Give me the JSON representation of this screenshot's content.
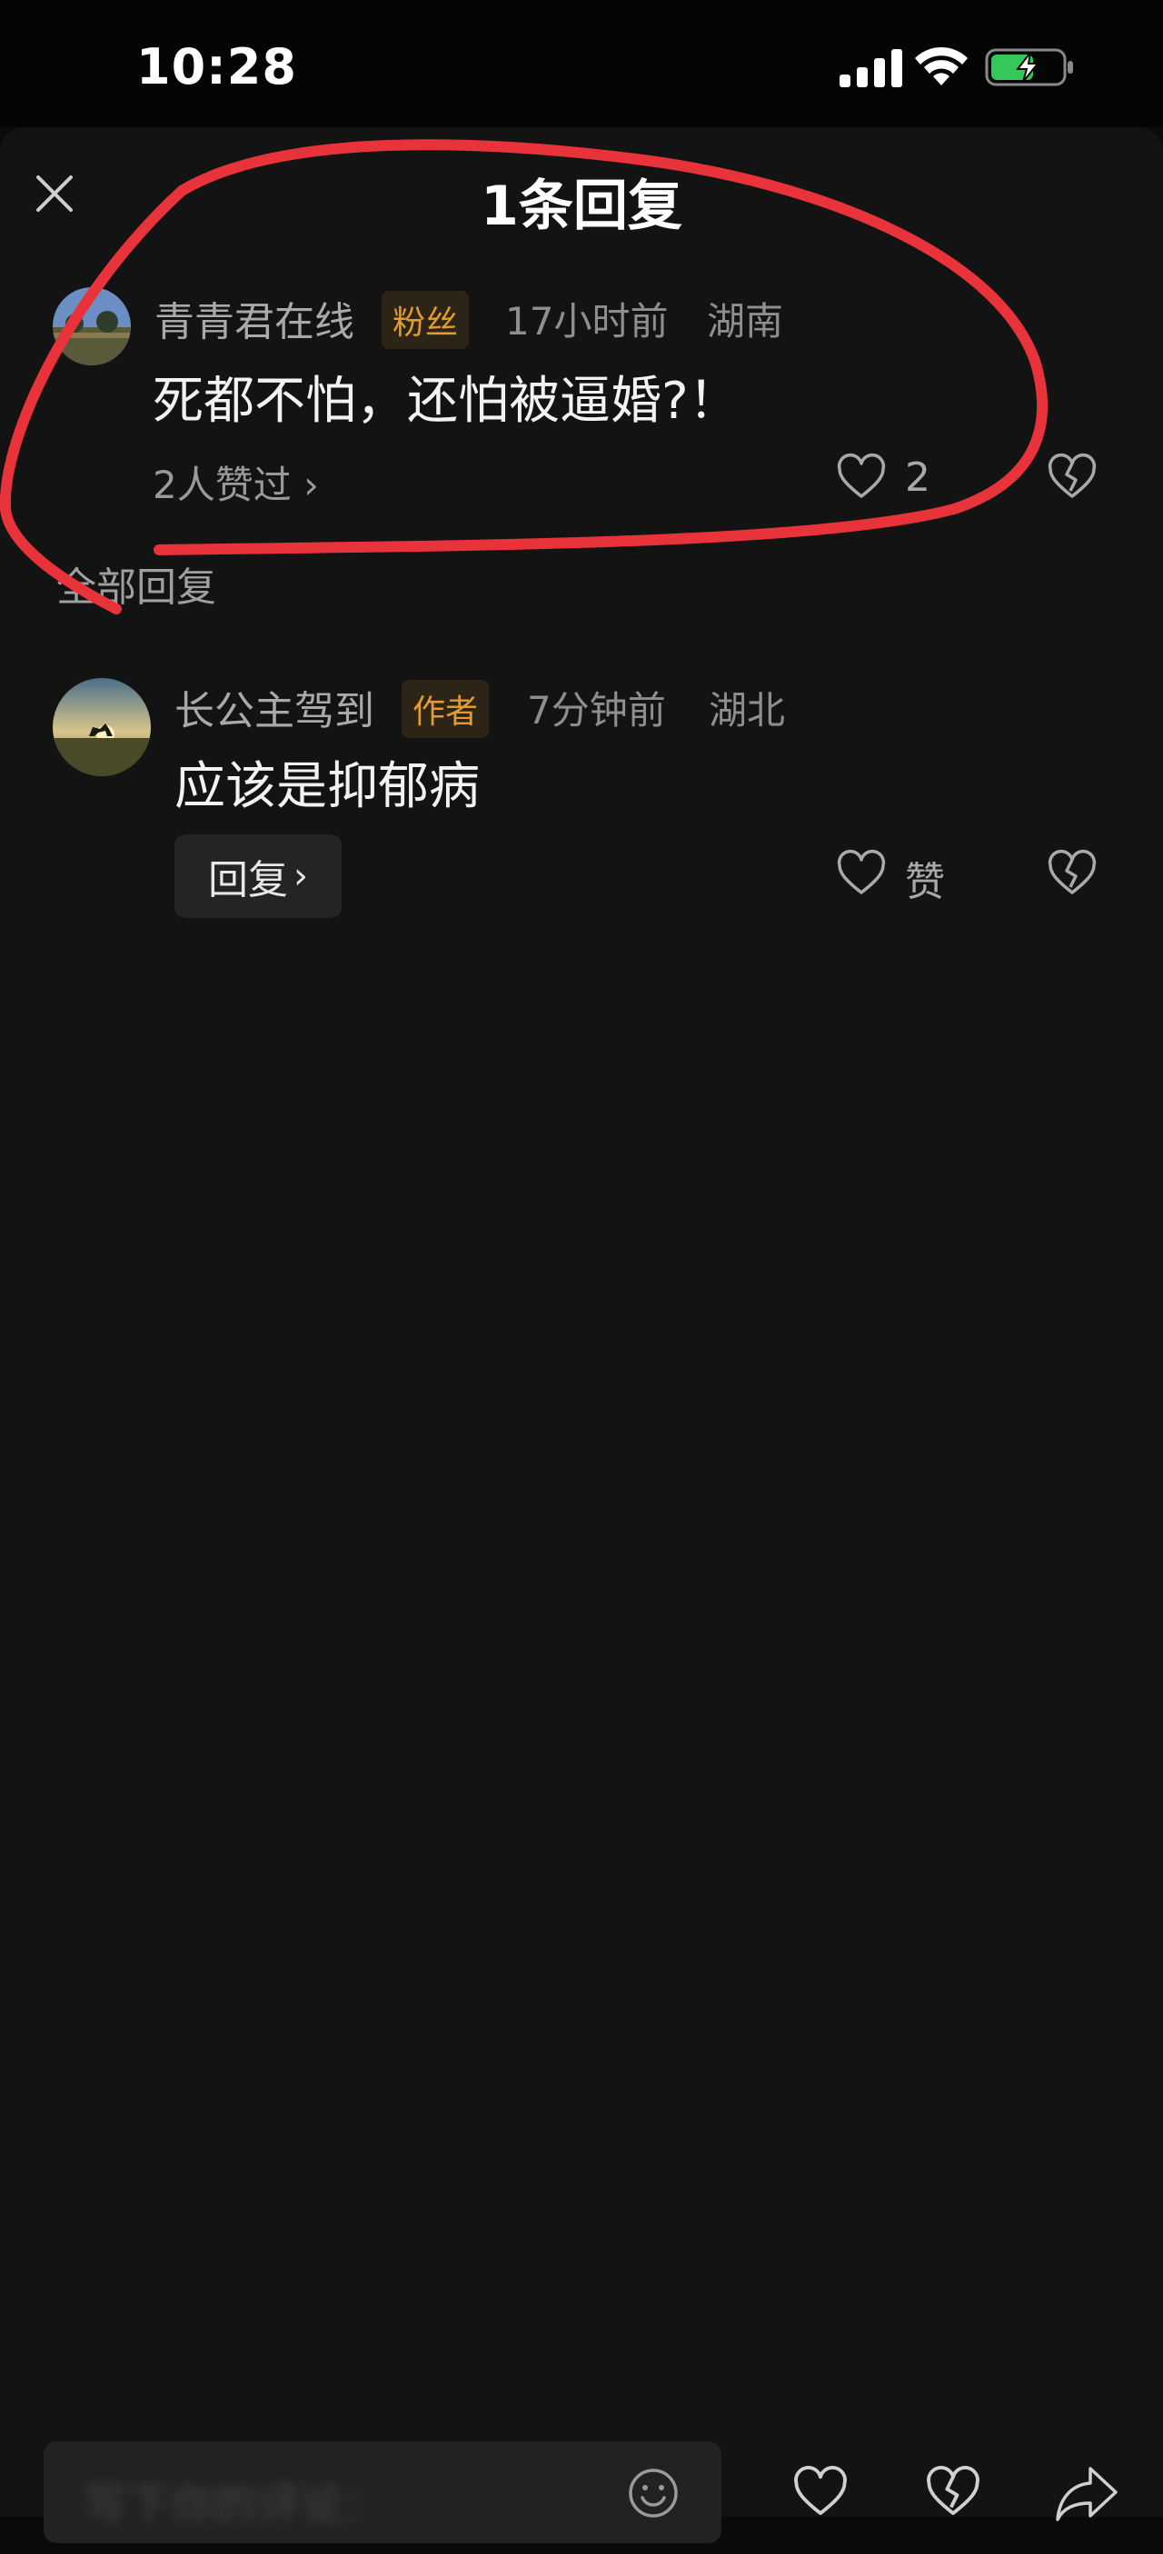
{
  "status_bar": {
    "time": "10:28"
  },
  "sheet": {
    "title": "1条回复",
    "close_icon": "close-icon"
  },
  "main_comment": {
    "username": "青青君在线",
    "badge": "粉丝",
    "time": "17小时前",
    "location": "湖南",
    "text": "死都不怕，还怕被逼婚?！",
    "likers": "2人赞过",
    "like_count": "2"
  },
  "section_label": "全部回复",
  "reply": {
    "username": "长公主驾到",
    "badge": "作者",
    "time": "7分钟前",
    "location": "湖北",
    "text": "应该是抑郁病",
    "reply_button": "回复",
    "like_label": "赞"
  },
  "bottom_bar": {
    "input_placeholder": "写下你的评论：",
    "icons": [
      "emoji-icon",
      "heart-icon",
      "broken-heart-icon",
      "share-icon"
    ]
  },
  "colors": {
    "background": "#131313",
    "badge_text": "#e39b2e",
    "annotation": "#e8333b",
    "battery_fill": "#34c759"
  }
}
